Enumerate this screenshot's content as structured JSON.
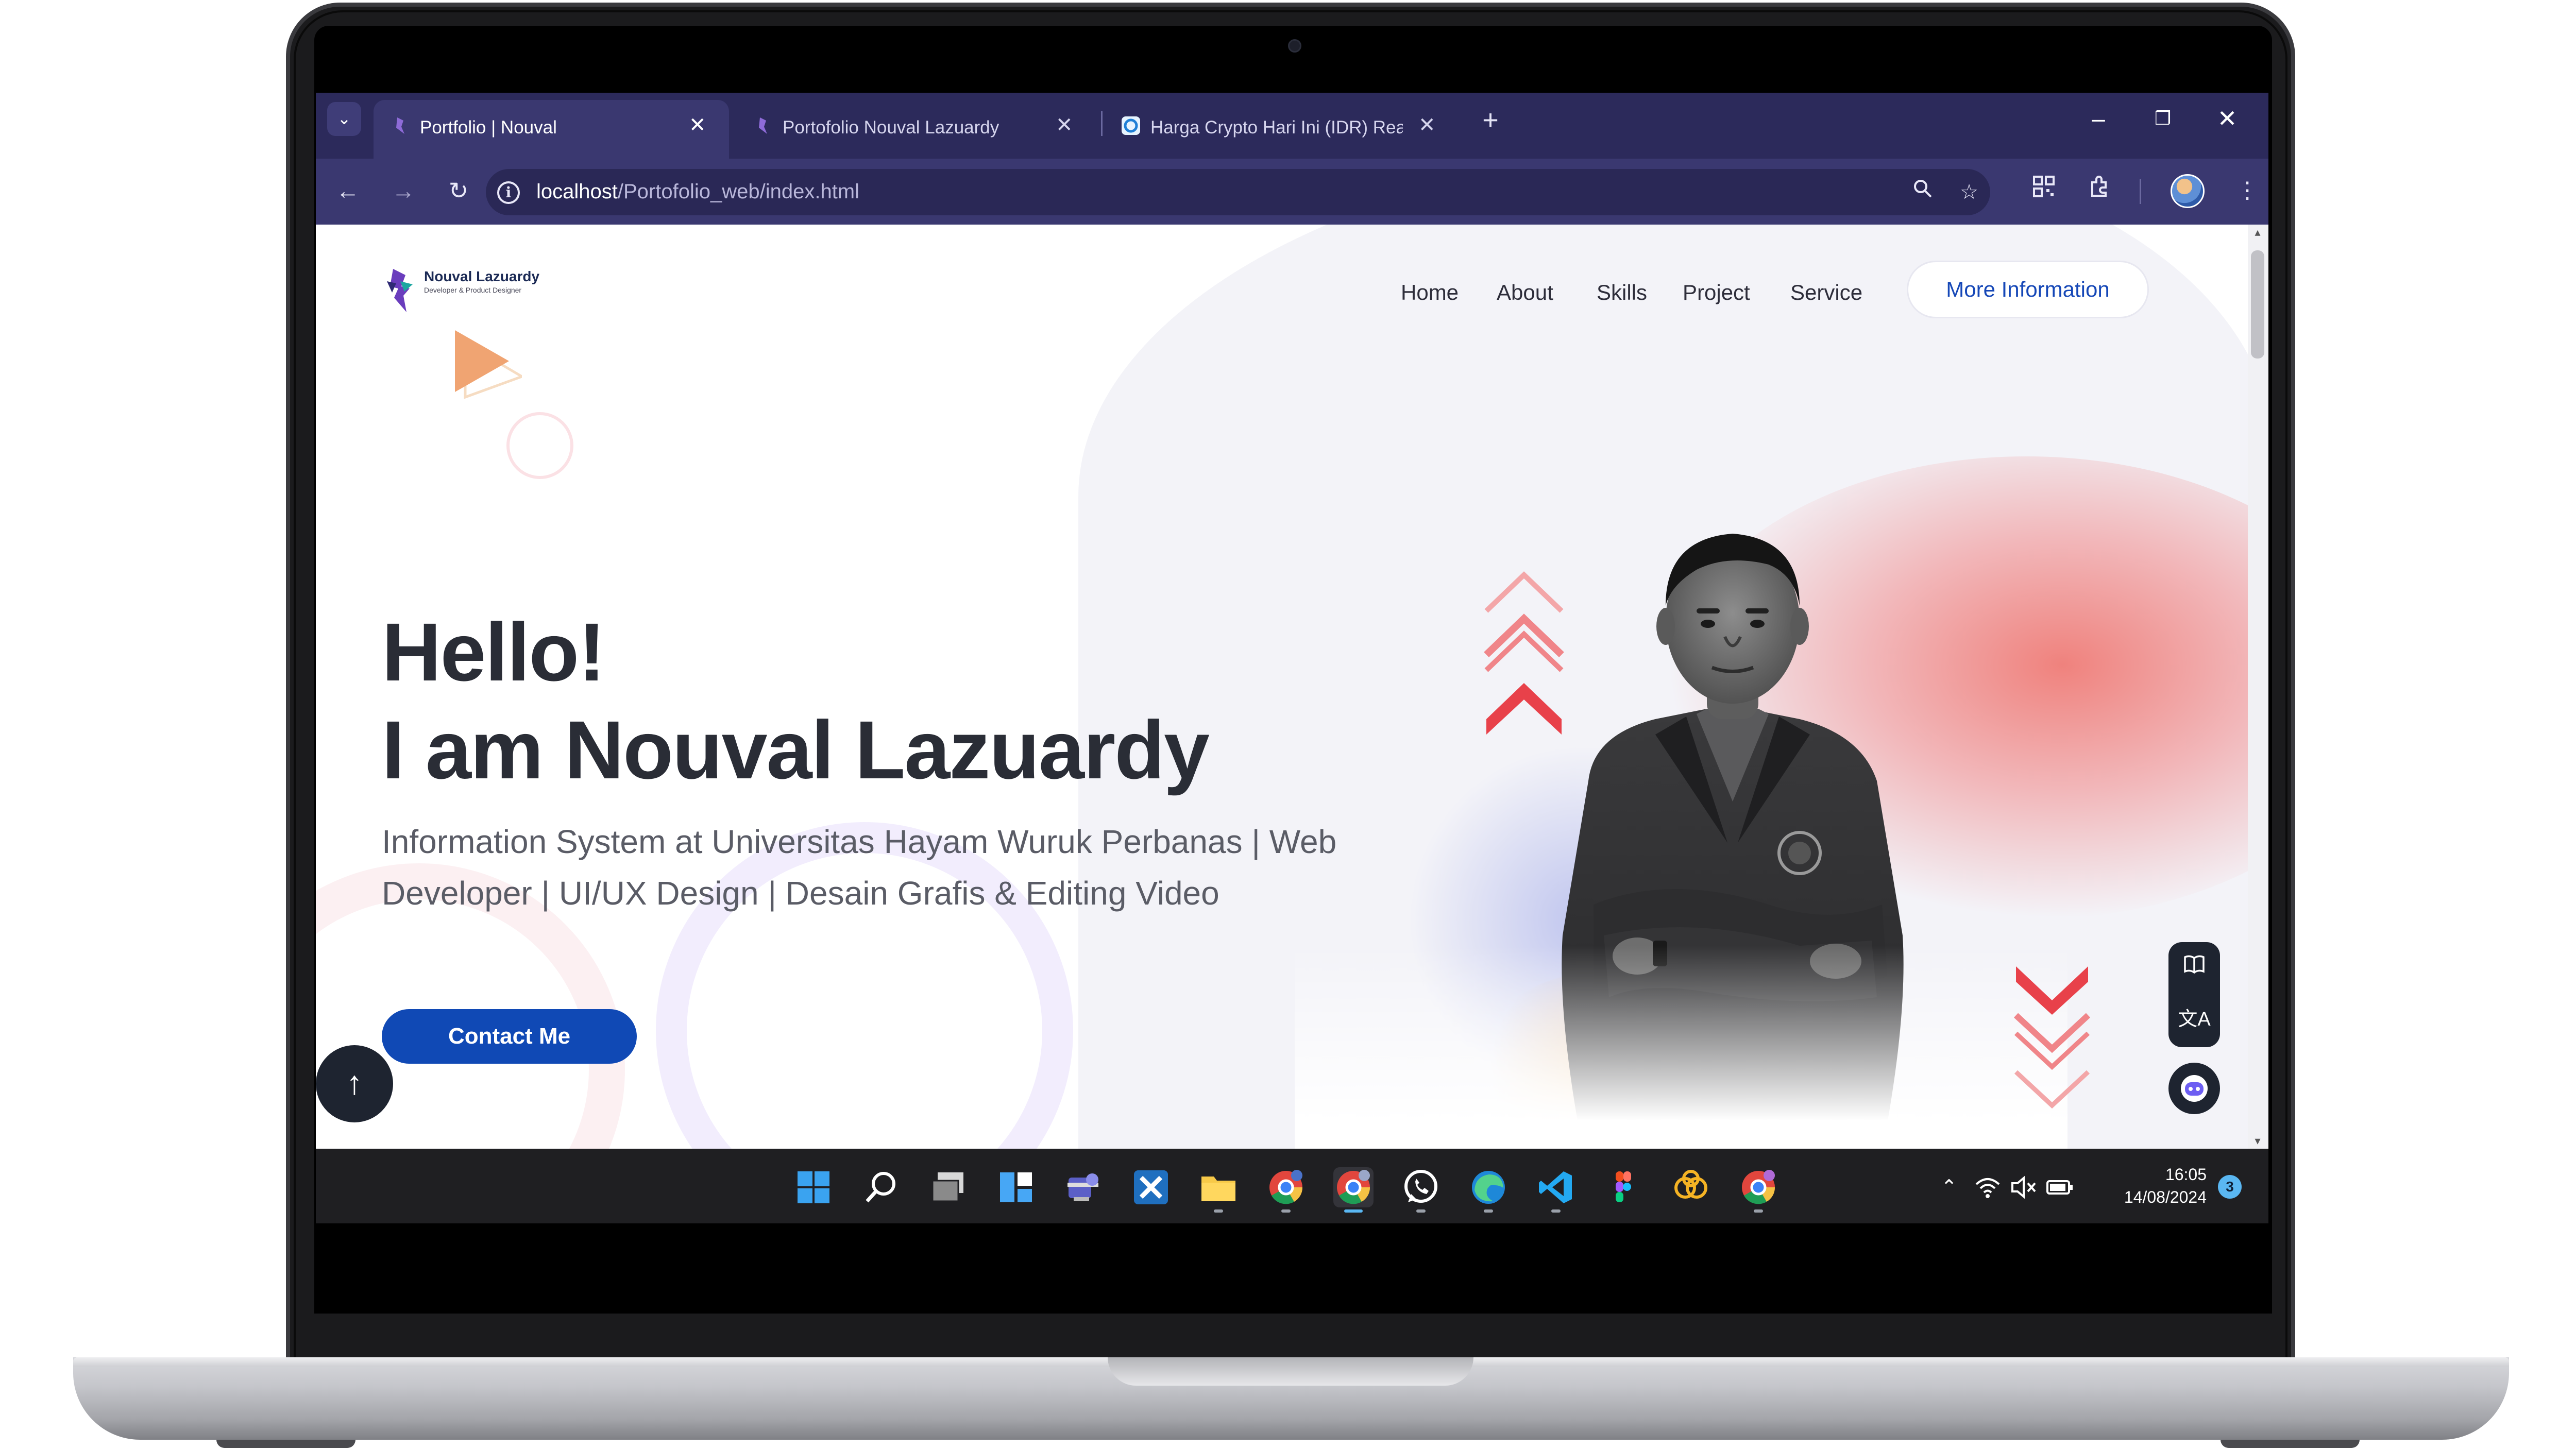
{
  "browser": {
    "tabs": [
      {
        "title": "Portfolio | Nouval",
        "active": true
      },
      {
        "title": "Portofolio Nouval Lazuardy",
        "active": false
      },
      {
        "title": "Harga Crypto Hari Ini (IDR) Real",
        "active": false
      }
    ],
    "address": {
      "host": "localhost",
      "path": "/Portofolio_web/index.html"
    }
  },
  "site": {
    "logo": {
      "name": "Nouval Lazuardy",
      "tagline": "Developer & Product Designer"
    },
    "nav": [
      "Home",
      "About",
      "Skills",
      "Project",
      "Service"
    ],
    "more_info": "More Information",
    "hero": {
      "greeting": "Hello!",
      "name_line": "I am Nouval Lazuardy",
      "description": "Information System at Universitas Hayam Wuruk Perbanas | Web Developer | UI/UX Design | Desain Grafis & Editing Video",
      "cta": "Contact Me"
    }
  },
  "taskbar": {
    "time": "16:05",
    "date": "14/08/2024",
    "notification_count": "3",
    "apps": [
      "windows-start-icon",
      "search-icon",
      "task-view-icon",
      "widgets-icon",
      "teams-icon",
      "xampp-icon",
      "file-explorer-icon",
      "chrome-icon",
      "chrome-icon",
      "whatsapp-icon",
      "edge-icon",
      "vscode-icon",
      "figma-icon",
      "photo-app-icon",
      "chrome-icon"
    ]
  },
  "colors": {
    "tabbar": "#2c2a5b",
    "toolbar": "#3a3870",
    "accent_blue": "#1049b5",
    "heading": "#2a2d36",
    "red_accent": "#e8414a"
  }
}
